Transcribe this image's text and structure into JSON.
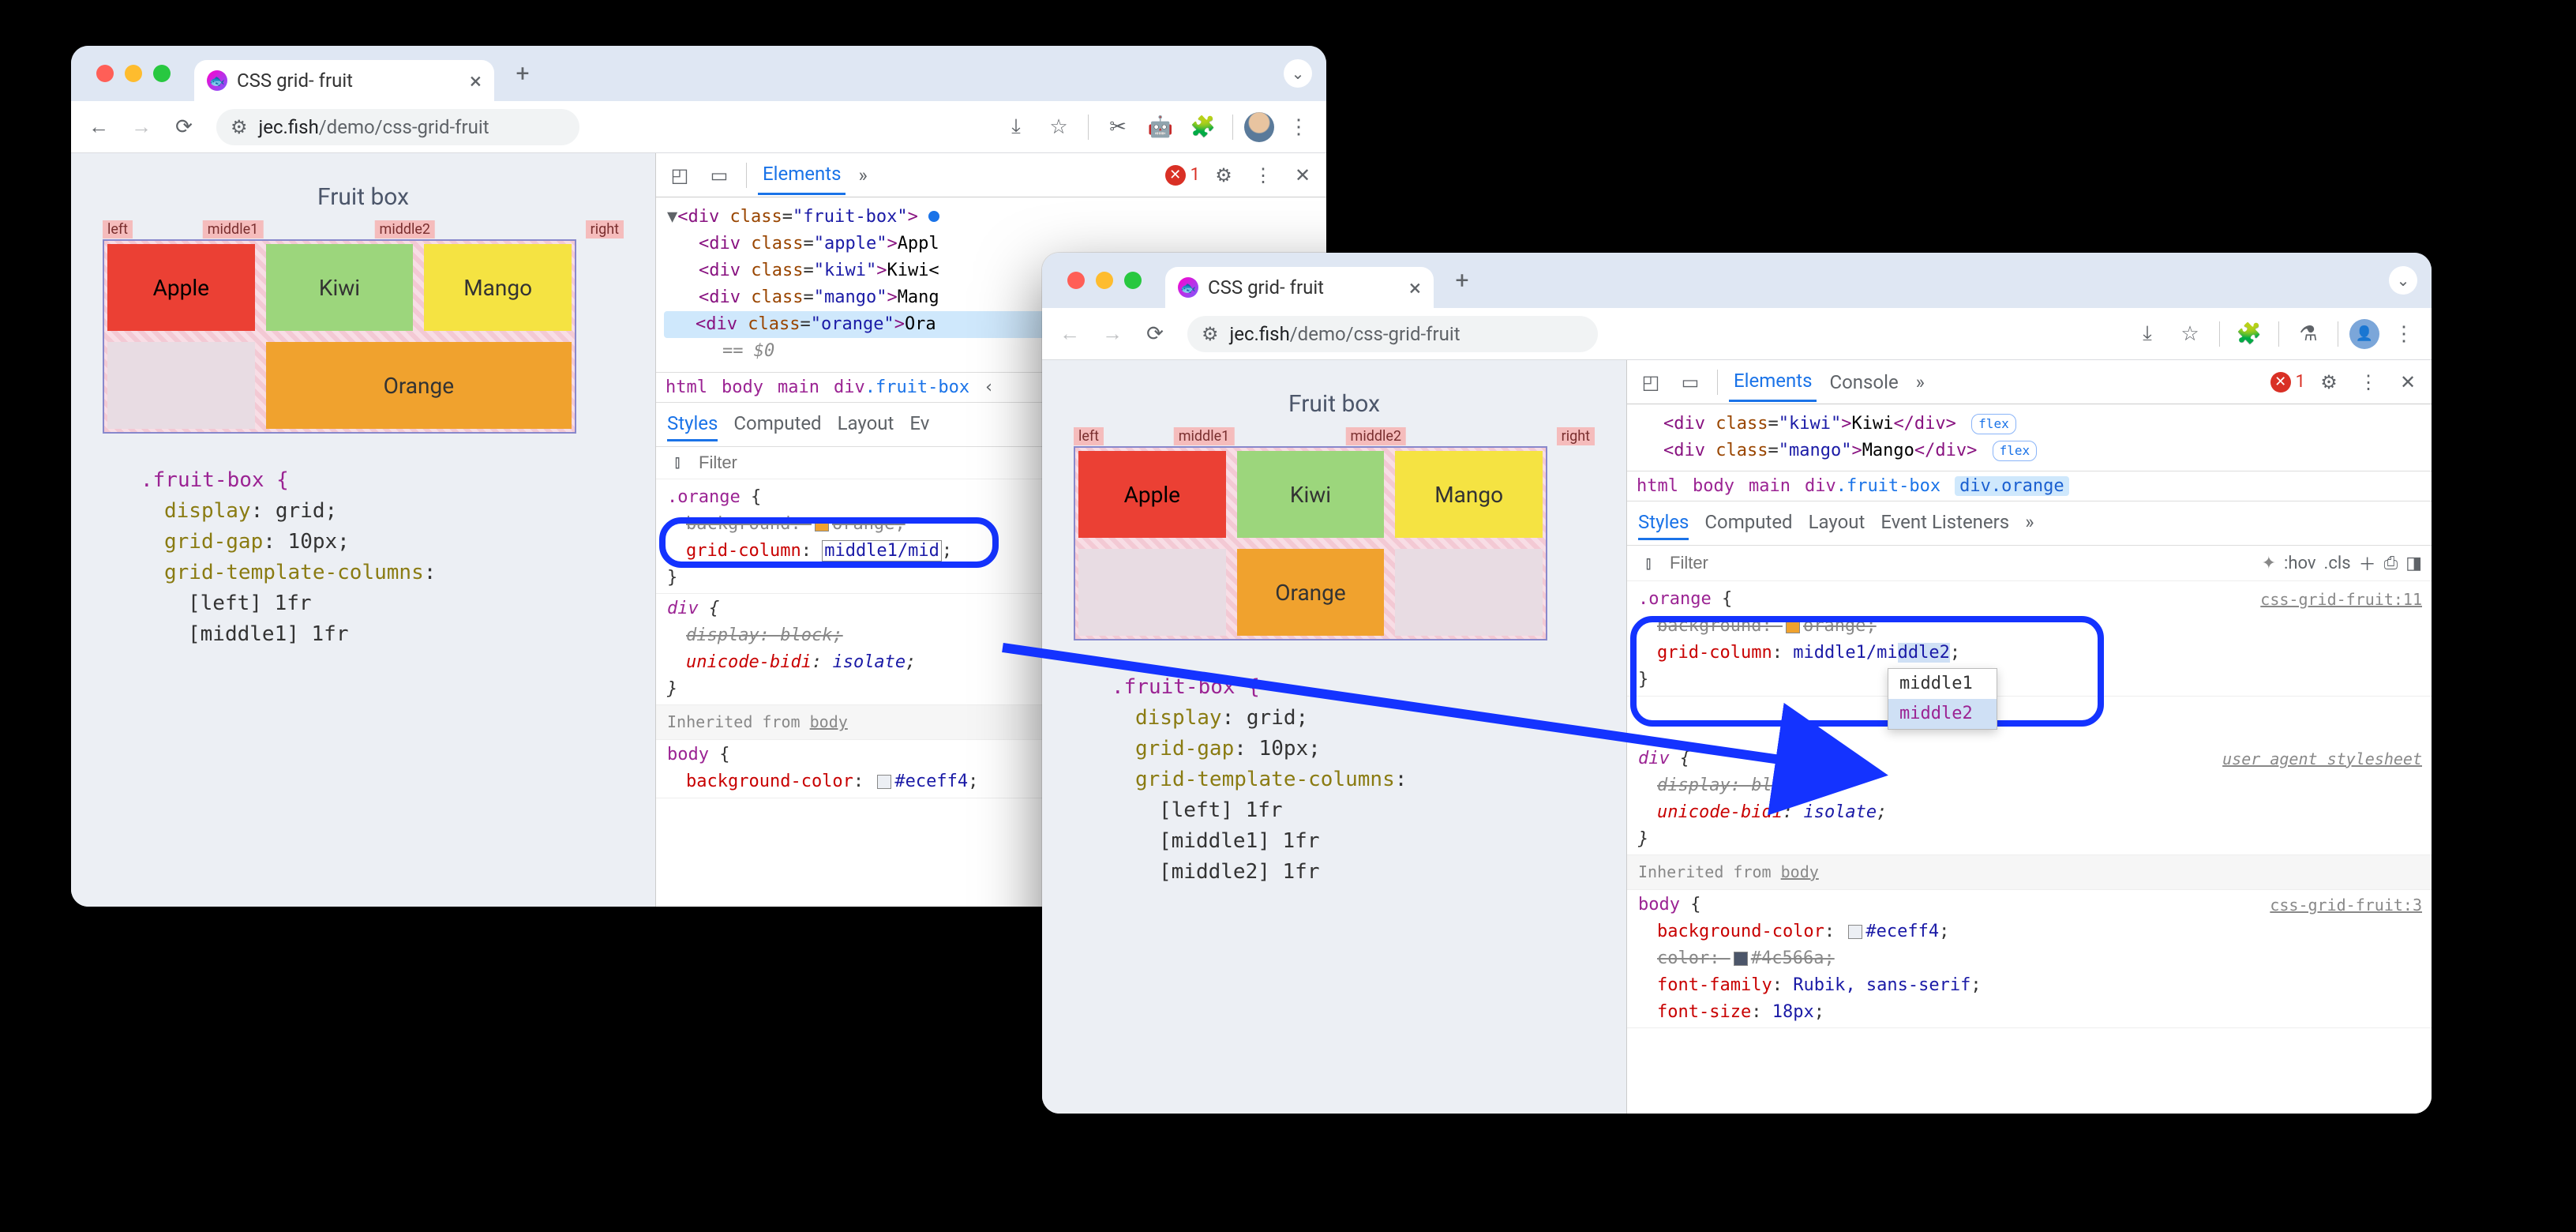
{
  "tab_title": "CSS grid- fruit",
  "url_host": "jec.fish",
  "url_path": "/demo/css-grid-fruit",
  "page": {
    "heading": "Fruit box",
    "labels": {
      "left": "left",
      "middle1": "middle1",
      "middle2": "middle2",
      "right": "right"
    },
    "cells": {
      "apple": "Apple",
      "kiwi": "Kiwi",
      "mango": "Mango",
      "orange": "Orange"
    },
    "css": {
      "selector": ".fruit-box {",
      "l1": "display: grid;",
      "l2": "grid-gap: 10px;",
      "l3": "grid-template-columns:",
      "l4": "[left] 1fr",
      "l5": "[middle1] 1fr",
      "l6": "[middle2] 1fr"
    }
  },
  "devtools": {
    "tabs": {
      "elements": "Elements",
      "console": "Console",
      "more": "»"
    },
    "errors": "1",
    "dom": {
      "fruitbox_open": "<div class=\"fruit-box\">",
      "apple": "<div class=\"apple\">Appl",
      "kiwi": "<div class=\"kiwi\">Kiwi<",
      "kiwi_full": "<div class=\"kiwi\">Kiwi</div>",
      "mango": "<div class=\"mango\">Mang",
      "mango_full": "<div class=\"mango\">Mango</div>",
      "orange": "<div class=\"orange\">Ora",
      "eqdollar": "== $0",
      "flex": "flex"
    },
    "crumbs": {
      "html": "html",
      "body": "body",
      "main": "main",
      "fruitbox": "div.fruit-box",
      "orange": "div.orange"
    },
    "subtabs": {
      "styles": "Styles",
      "computed": "Computed",
      "layout": "Layout",
      "events": "Event Listeners",
      "events_short": "Ev",
      "more": "»"
    },
    "filter": {
      "placeholder": "Filter",
      "hov": ":hov",
      "cls": ".cls"
    },
    "rules": {
      "orange_sel": ".orange {",
      "background_strike": "background: ▮ orange;",
      "gridcol_prop": "grid-column",
      "gridcol_val_a": "middle1/mid",
      "gridcol_val_b": "middle1/middle2",
      "close": "}",
      "div_sel": "div {",
      "display_block": "display: block;",
      "unicode_bidi": "unicode-bidi: isolate;",
      "inherited_from": "Inherited from",
      "body": "body",
      "body_sel": "body {",
      "bgcolor": "background-color:",
      "eceff4": "#eceff4;",
      "color_strike": "color: ▮ #4c566a;",
      "fontfam": "font-family: Rubik, sans-serif;",
      "fontsize": "font-size: 18px;",
      "ua": "user agent stylesheet",
      "ua_short": "us",
      "src1": "css-grid-fruit:11",
      "src2": "css-grid-fruit:3"
    },
    "autocomplete": {
      "opt1": "middle1",
      "opt2": "middle2"
    }
  }
}
